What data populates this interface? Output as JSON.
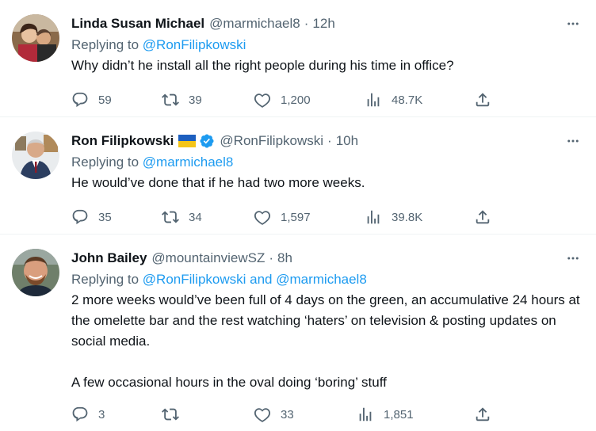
{
  "tweets": [
    {
      "name": "Linda Susan Michael",
      "handle": "@marmichael8",
      "dot": "·",
      "time": "12h",
      "replying_prefix": "Replying to ",
      "replying_to": "@RonFilipkowski",
      "replying_and": "",
      "replying_to2": "",
      "text": [
        "Why didn’t he install all the right people during his time in office?"
      ],
      "replies": "59",
      "retweets": "39",
      "likes": "1,200",
      "views": "48.7K"
    },
    {
      "name": "Ron Filipkowski",
      "flag_icon": "ukraine-flag-icon",
      "verified_icon": "verified-badge-icon",
      "handle": "@RonFilipkowski",
      "dot": "·",
      "time": "10h",
      "replying_prefix": "Replying to ",
      "replying_to": "@marmichael8",
      "replying_and": "",
      "replying_to2": "",
      "text": [
        "He would’ve done that if he had two more weeks."
      ],
      "replies": "35",
      "retweets": "34",
      "likes": "1,597",
      "views": "39.8K"
    },
    {
      "name": "John Bailey",
      "handle": "@mountainviewSZ",
      "dot": "·",
      "time": "8h",
      "replying_prefix": "Replying to ",
      "replying_to": "@RonFilipkowski",
      "replying_and": " and ",
      "replying_to2": "@marmichael8",
      "text": [
        "2 more weeks would’ve been full of 4 days on the green, an accumulative 24 hours at the omelette bar and the rest watching ‘haters’ on television & posting updates on social media.",
        "A few occasional hours in the oval doing ‘boring’ stuff"
      ],
      "replies": "3",
      "retweets": "",
      "likes": "33",
      "views": "1,851"
    }
  ],
  "colors": {
    "text": "#0f1419",
    "secondary": "#536471",
    "link": "#1d9bf0",
    "verified": "#1d9bf0"
  }
}
